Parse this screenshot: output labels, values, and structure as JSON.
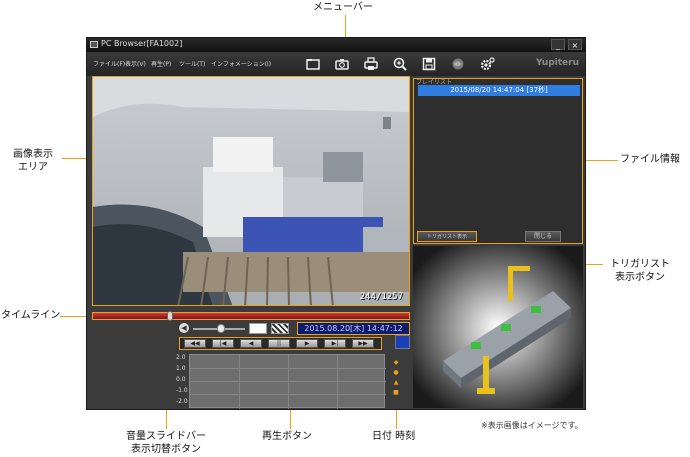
{
  "annotations": {
    "menubar": "メニューバー",
    "video_area_l1": "画像表示",
    "video_area_l2": "エリア",
    "file_info": "ファイル情報",
    "timeline": "タイムライン",
    "trigger_l1": "トリガリスト",
    "trigger_l2": "表示ボタン",
    "volume_l1": "音量スライドバー",
    "volume_l2": "表示切替ボタン",
    "playback": "再生ボタン",
    "datetime": "日付 時刻",
    "note": "※表示画像はイメージです。"
  },
  "window": {
    "title": "PC Browser[FA1002]",
    "minimize": "_",
    "close": "×"
  },
  "menu": {
    "items": [
      "ファイル(F)",
      "表示(V)",
      "再生(P)",
      "ツール(T)",
      "インフォメーション(I)"
    ]
  },
  "toolbar": {
    "icons": [
      "folder-icon",
      "camera-icon",
      "print-icon",
      "zoom-icon",
      "save-icon",
      "map-icon",
      "settings-icon"
    ],
    "brand": "Yupiteru"
  },
  "video": {
    "frame_counter": "244/1257"
  },
  "player": {
    "datetime": "2015.08.20[木] 14:47:12",
    "timeline_position": 0.24,
    "volume_level": 0.55,
    "buttons": [
      "◀◀",
      "|◀",
      "◀",
      "||",
      "▶",
      "▶|",
      "▶▶"
    ]
  },
  "graph": {
    "y_ticks": [
      "2.0",
      "1.0",
      "0.0",
      "-1.0",
      "-2.0"
    ]
  },
  "file_panel": {
    "tab_label": "プレイリスト",
    "entry": "2015/08/20 14:47:04 [37秒]",
    "trigger_button": "トリガリスト表示",
    "close_button": "閉じる"
  }
}
